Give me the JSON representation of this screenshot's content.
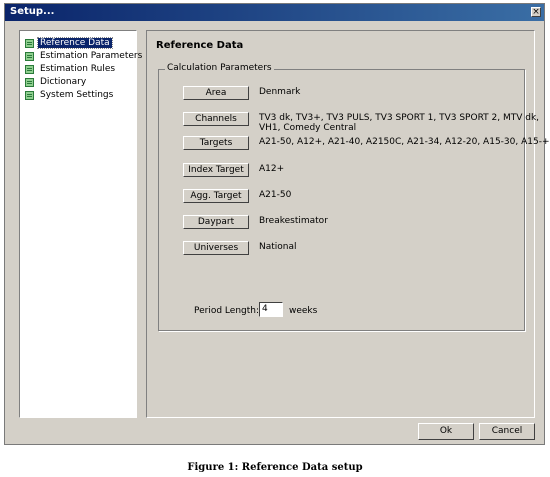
{
  "window": {
    "title": "Setup...",
    "close_glyph": "×"
  },
  "tree": {
    "items": [
      {
        "label": "Reference Data",
        "icon": "document-list-icon",
        "selected": true
      },
      {
        "label": "Estimation Parameters",
        "icon": "document-list-icon"
      },
      {
        "label": "Estimation Rules",
        "icon": "document-list-icon"
      },
      {
        "label": "Dictionary",
        "icon": "document-list-icon"
      },
      {
        "label": "System Settings",
        "icon": "document-list-icon"
      }
    ]
  },
  "panel": {
    "title": "Reference Data",
    "group_legend": "Calculation Parameters",
    "params": [
      {
        "button": "Area",
        "value": "Denmark"
      },
      {
        "button": "Channels",
        "value": "TV3 dk, TV3+, TV3 PULS, TV3 SPORT 1, TV3 SPORT 2, MTV dk,",
        "value2": "VH1, Comedy Central"
      },
      {
        "button": "Targets",
        "value": "A21-50, A12+, A21-40, A2150C, A21-34, A12-20, A15-30, A15-+"
      },
      {
        "button": "Index Target",
        "value": "A12+"
      },
      {
        "button": "Agg. Target",
        "value": "A21-50"
      },
      {
        "button": "Daypart",
        "value": "Breakestimator"
      },
      {
        "button": "Universes",
        "value": "National"
      }
    ],
    "period_label": "Period Length:",
    "period_value": "4",
    "period_unit": "weeks"
  },
  "footer": {
    "ok_label": "Ok",
    "cancel_label": "Cancel"
  },
  "caption": "Figure 1: Reference Data setup"
}
